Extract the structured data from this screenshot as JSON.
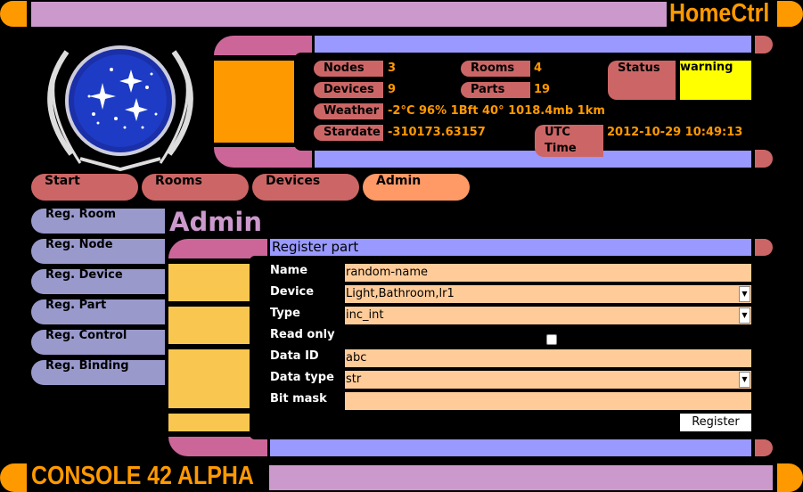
{
  "app": {
    "title": "HomeCtrl",
    "footer": "CONSOLE 42 ALPHA"
  },
  "stats": {
    "nodes": {
      "label": "Nodes",
      "value": "3"
    },
    "rooms": {
      "label": "Rooms",
      "value": "4"
    },
    "devices": {
      "label": "Devices",
      "value": "9"
    },
    "parts": {
      "label": "Parts",
      "value": "19"
    },
    "status": {
      "label": "Status",
      "value": "warning"
    },
    "weather": {
      "label": "Weather",
      "value": "-2°C 96% 1Bft 40° 1018.4mb 1km"
    },
    "stardate": {
      "label": "Stardate",
      "value": "-310173.63157"
    },
    "utc": {
      "label": "UTC Time",
      "value": "2012-10-29 10:49:13"
    }
  },
  "tabs": [
    {
      "label": "Start"
    },
    {
      "label": "Rooms"
    },
    {
      "label": "Devices"
    },
    {
      "label": "Admin",
      "active": true
    }
  ],
  "sidebar": [
    {
      "label": "Reg. Room"
    },
    {
      "label": "Reg. Node"
    },
    {
      "label": "Reg. Device"
    },
    {
      "label": "Reg. Part"
    },
    {
      "label": "Reg. Control"
    },
    {
      "label": "Reg. Binding"
    }
  ],
  "page": {
    "title": "Admin"
  },
  "form": {
    "title": "Register part",
    "name": {
      "label": "Name",
      "value": "random-name"
    },
    "device": {
      "label": "Device",
      "value": "Light,Bathroom,lr1"
    },
    "type": {
      "label": "Type",
      "value": "inc_int"
    },
    "readonly": {
      "label": "Read only",
      "checked": false
    },
    "dataid": {
      "label": "Data ID",
      "value": "abc"
    },
    "datatype": {
      "label": "Data type",
      "value": "str"
    },
    "bitmask": {
      "label": "Bit mask",
      "value": ""
    },
    "submit": "Register"
  },
  "colors": {
    "accent": "#ff9900",
    "status_warning": "#ffff00",
    "frame_blue": "#9999ff",
    "frame_purple": "#cc99cc"
  }
}
